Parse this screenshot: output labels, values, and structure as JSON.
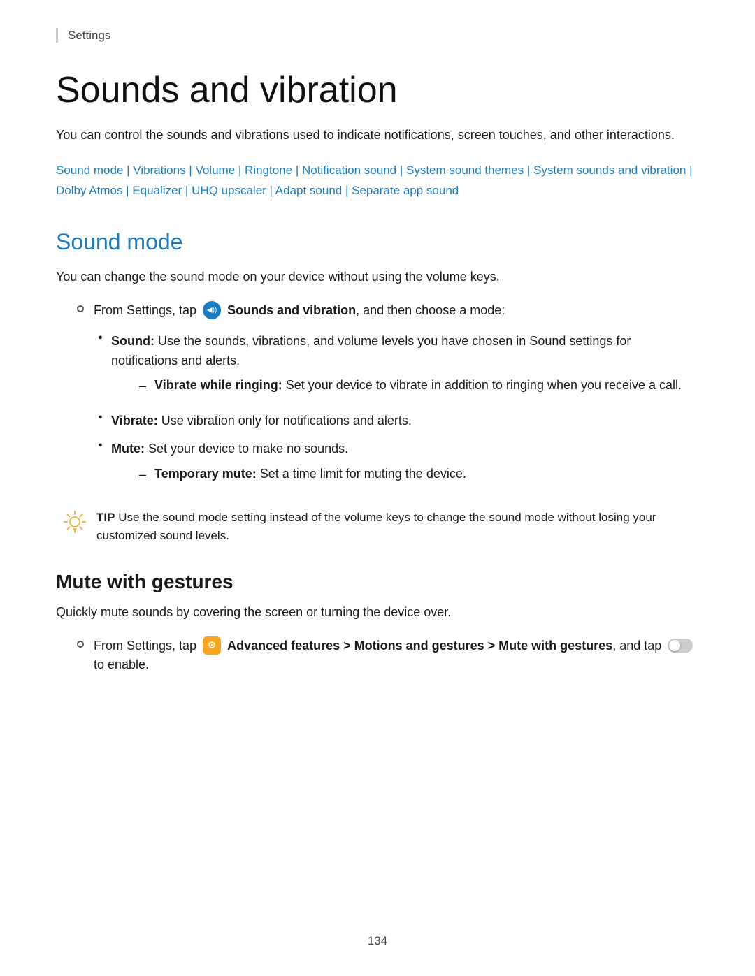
{
  "breadcrumb": {
    "label": "Settings"
  },
  "page": {
    "title": "Sounds and vibration",
    "intro": "You can control the sounds and vibrations used to indicate notifications, screen touches, and other interactions.",
    "page_number": "134"
  },
  "nav_links": {
    "items": [
      "Sound mode",
      "Vibrations",
      "Volume",
      "Ringtone",
      "Notification sound",
      "System sound themes",
      "System sounds and vibration",
      "Dolby Atmos",
      "Equalizer",
      "UHQ upscaler",
      "Adapt sound",
      "Separate app sound"
    ]
  },
  "sound_mode_section": {
    "heading": "Sound mode",
    "description": "You can change the sound mode on your device without using the volume keys.",
    "instruction": {
      "prefix": "From Settings, tap",
      "icon_name": "sounds-and-vibration-icon",
      "app_label": "Sounds and vibration",
      "suffix": ", and then choose a mode:"
    },
    "items": [
      {
        "label": "Sound",
        "description": "Use the sounds, vibrations, and volume levels you have chosen in Sound settings for notifications and alerts.",
        "sub_items": [
          {
            "label": "Vibrate while ringing",
            "description": "Set your device to vibrate in addition to ringing when you receive a call."
          }
        ]
      },
      {
        "label": "Vibrate",
        "description": "Use vibration only for notifications and alerts.",
        "sub_items": []
      },
      {
        "label": "Mute",
        "description": "Set your device to make no sounds.",
        "sub_items": [
          {
            "label": "Temporary mute",
            "description": "Set a time limit for muting the device."
          }
        ]
      }
    ],
    "tip": {
      "label": "TIP",
      "text": "Use the sound mode setting instead of the volume keys to change the sound mode without losing your customized sound levels."
    }
  },
  "mute_gestures_section": {
    "heading": "Mute with gestures",
    "description": "Quickly mute sounds by covering the screen or turning the device over.",
    "instruction": {
      "prefix": "From Settings, tap",
      "icon_name": "advanced-features-icon",
      "app_label": "Advanced features > Motions and gestures > Mute with gestures",
      "suffix_prefix": ", and tap",
      "suffix": "to enable."
    }
  }
}
